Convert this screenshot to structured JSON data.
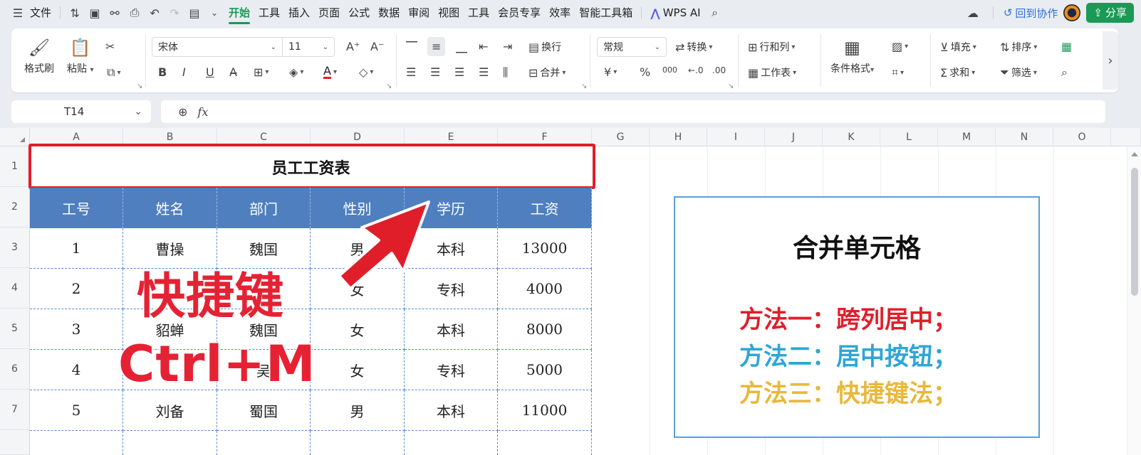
{
  "menubar": {
    "file_label": "文件",
    "tabs": [
      "开始",
      "工具",
      "插入",
      "页面",
      "公式",
      "数据",
      "审阅",
      "视图",
      "工具",
      "会员专享",
      "效率",
      "智能工具箱"
    ],
    "active_tab": "开始",
    "wps_ai": "WPS AI",
    "collab": "回到协作",
    "share": "分享"
  },
  "ribbon": {
    "format_painter": "格式刷",
    "paste": "粘贴",
    "font_name": "宋体",
    "font_size": "11",
    "wrap": "换行",
    "merge": "合并",
    "number_format": "常规",
    "convert": "转换",
    "rows_cols": "行和列",
    "worksheet": "工作表",
    "cond_format": "条件格式",
    "fill": "填充",
    "sort": "排序",
    "sum": "求和",
    "filter": "筛选",
    "percent": "%",
    "yuan": "¥",
    "thousands": "000"
  },
  "formula": {
    "cell_ref": "T14",
    "fx": "fx",
    "content": ""
  },
  "columns": [
    "A",
    "B",
    "C",
    "D",
    "E",
    "F",
    "G",
    "H",
    "I",
    "J",
    "K",
    "L",
    "M",
    "N",
    "O"
  ],
  "rows": [
    "1",
    "2",
    "3",
    "4",
    "5",
    "6",
    "7"
  ],
  "table": {
    "title": "员工工资表",
    "headers": [
      "工号",
      "姓名",
      "部门",
      "性别",
      "学历",
      "工资"
    ],
    "data": [
      [
        "1",
        "曹操",
        "魏国",
        "男",
        "本科",
        "13000"
      ],
      [
        "2",
        "",
        "",
        "女",
        "专科",
        "4000"
      ],
      [
        "3",
        "貂蝉",
        "魏国",
        "女",
        "本科",
        "8000"
      ],
      [
        "4",
        "",
        "吴",
        "女",
        "专科",
        "5000"
      ],
      [
        "5",
        "刘备",
        "蜀国",
        "男",
        "本科",
        "11000"
      ]
    ]
  },
  "overlay": {
    "line1": "快捷键",
    "line2": "Ctrl+M"
  },
  "infobox": {
    "title": "合并单元格",
    "method1": "方法一：跨列居中；",
    "method2": "方法二：居中按钮；",
    "method3": "方法三：快捷键法；"
  },
  "colors": {
    "accent_green": "#1a9a55",
    "header_blue": "#4f7fbf",
    "highlight_red": "#e01e2a",
    "method1": "#e01e2a",
    "method2": "#2ea6d6",
    "method3": "#e8b83a"
  },
  "icons": {
    "undo": "undo-icon",
    "redo": "redo-icon",
    "save": "save-icon",
    "search": "search-icon",
    "zoom": "zoom-icon"
  }
}
